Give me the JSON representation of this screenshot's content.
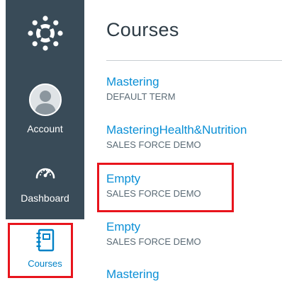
{
  "global_nav": {
    "logo_icon": "canvas-logo-icon",
    "account_label": "Account",
    "dashboard_label": "Dashboard",
    "courses_label": "Courses",
    "nav_bg_color": "#394b58",
    "active_link_color": "#0081c6"
  },
  "courses_tray": {
    "title": "Courses",
    "courses": [
      {
        "name": "Mastering",
        "term": "DEFAULT TERM"
      },
      {
        "name": "MasteringHealth&Nutrition",
        "term": "SALES FORCE DEMO"
      },
      {
        "name": "Empty",
        "term": "SALES FORCE DEMO"
      },
      {
        "name": "Empty",
        "term": "SALES FORCE DEMO"
      },
      {
        "name": "Mastering",
        "term": ""
      }
    ]
  },
  "annotation_color": "#e8141c"
}
